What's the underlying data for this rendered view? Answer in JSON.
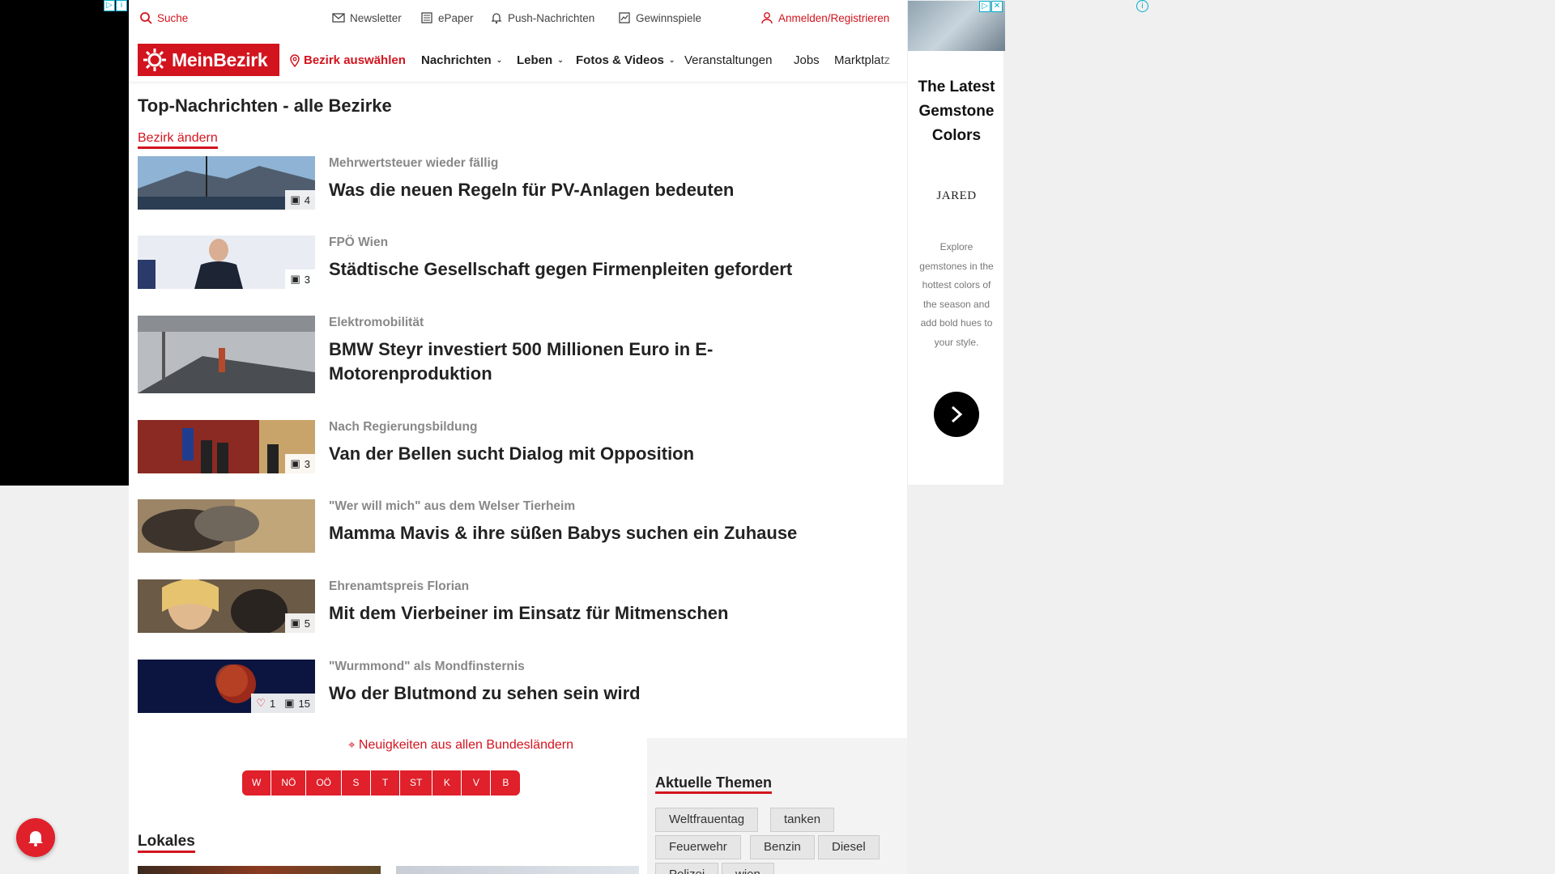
{
  "util": {
    "search": "Suche",
    "newsletter": "Newsletter",
    "epaper": "ePaper",
    "push": "Push-Nachrichten",
    "gewinnspiele": "Gewinnspiele",
    "login": "Anmelden/Registrieren"
  },
  "nav": {
    "logo": "MeinBezirk",
    "bezirk": "Bezirk auswählen",
    "items": [
      "Nachrichten",
      "Leben",
      "Fotos & Videos",
      "Veranstaltungen",
      "Jobs",
      "Marktplatz"
    ]
  },
  "page": {
    "title": "Top-Nachrichten - alle Bezirke",
    "change_district": "Bezirk ändern"
  },
  "articles": [
    {
      "kicker": "Mehrwertsteuer wieder fällig",
      "headline": "Was die neuen Regeln für PV-Anlagen bedeuten",
      "photos": "4"
    },
    {
      "kicker": "FPÖ Wien",
      "headline": "Städtische Gesellschaft gegen Firmenpleiten gefordert",
      "photos": "3"
    },
    {
      "kicker": "Elektromobilität",
      "headline_line1": "BMW Steyr investiert 500 Millionen Euro in E-",
      "headline_line2": "Motorenproduktion"
    },
    {
      "kicker": "Nach Regierungsbildung",
      "headline": "Van der Bellen sucht Dialog mit Opposition",
      "photos": "3"
    },
    {
      "kicker": "\"Wer will mich\" aus dem Welser Tierheim",
      "headline": "Mamma Mavis & ihre süßen Babys suchen ein Zuhause"
    },
    {
      "kicker": "Ehrenamtspreis Florian",
      "headline": "Mit dem Vierbeiner im Einsatz für Mitmenschen",
      "photos": "5"
    },
    {
      "kicker": "\"Wurmmond\" als Mondfinsternis",
      "headline": "Wo der Blutmond zu sehen sein wird",
      "likes": "1",
      "photos": "15"
    }
  ],
  "states": {
    "label": "Neuigkeiten aus allen Bundesländern",
    "items": [
      "W",
      "NÖ",
      "OÖ",
      "S",
      "T",
      "ST",
      "K",
      "V",
      "B"
    ]
  },
  "lokales": "Lokales",
  "topics": {
    "title": "Aktuelle Themen",
    "tags": [
      "Weltfrauentag",
      "tanken",
      "Feuerwehr",
      "Benzin",
      "Diesel",
      "Polizei",
      "wien"
    ]
  },
  "ad": {
    "title_line1": "The Latest",
    "title_line2": "Gemstone",
    "title_line3": "Colors",
    "brand": "JARED",
    "text": "Explore gemstones in the hottest colors of the season and add bold hues to your style."
  },
  "colors": {
    "brand_red": "#d2141e",
    "text": "#222222",
    "kicker_gray": "#888888"
  }
}
